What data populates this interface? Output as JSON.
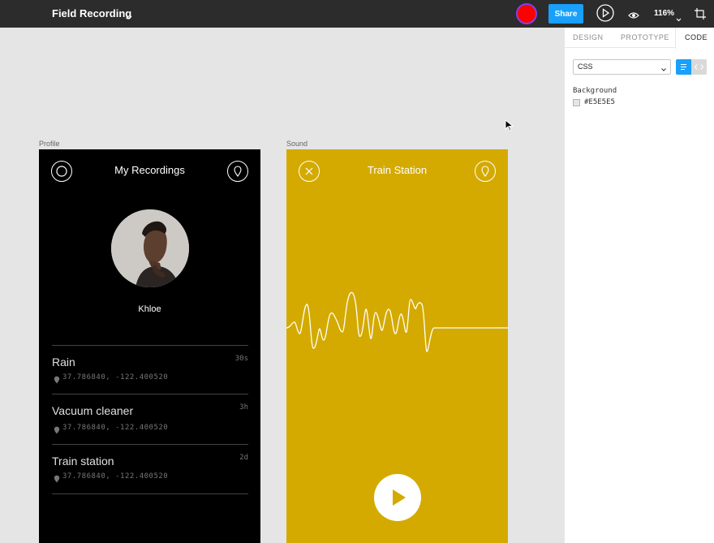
{
  "app": {
    "file_title": "Field Recording",
    "share_label": "Share",
    "zoom": "116%",
    "accent": "#18a0fb",
    "record_color": "#ff0000"
  },
  "panel": {
    "tabs": [
      "DESIGN",
      "PROTOTYPE",
      "CODE"
    ],
    "active_tab": "CODE",
    "language": "CSS",
    "background_label": "Background",
    "background_value": "#E5E5E5"
  },
  "frames": {
    "profile": {
      "label": "Profile",
      "title": "My Recordings",
      "name": "Khloe",
      "recordings": [
        {
          "name": "Rain",
          "time": "30s",
          "coords": "37.786840, -122.400520"
        },
        {
          "name": "Vacuum cleaner",
          "time": "3h",
          "coords": "37.786840, -122.400520"
        },
        {
          "name": "Train station",
          "time": "2d",
          "coords": "37.786840, -122.400520"
        }
      ]
    },
    "sound": {
      "label": "Sound",
      "title": "Train Station",
      "background": "#d4aa00"
    }
  },
  "icons": [
    "chevron-down-icon",
    "play-icon",
    "eye-icon",
    "frame-crop-icon",
    "close-icon",
    "location-pin-icon",
    "record-icon",
    "list-view-icon",
    "code-view-icon",
    "cursor-icon"
  ]
}
